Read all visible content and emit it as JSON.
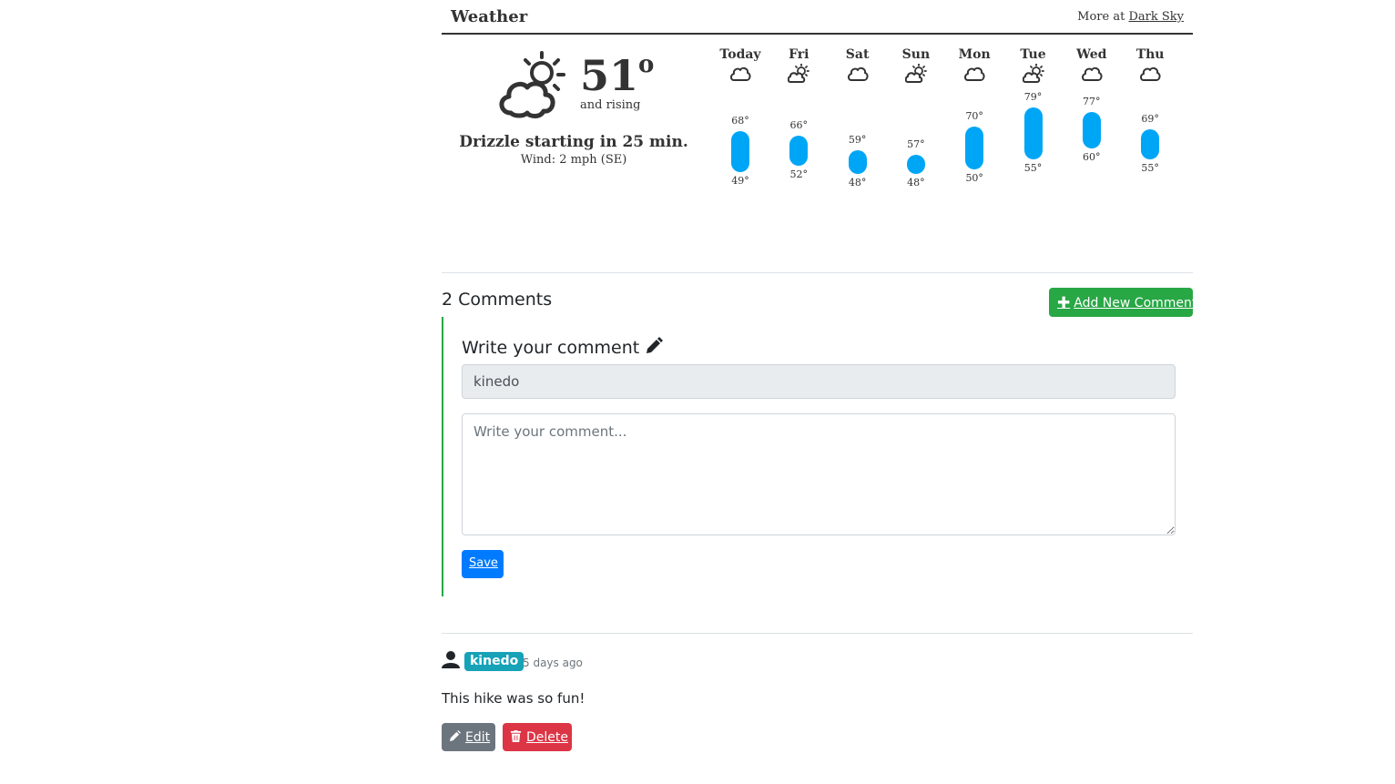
{
  "weather": {
    "title": "Weather",
    "more_prefix": "More at",
    "more_link": "Dark Sky",
    "current": {
      "temp": "51",
      "degree": "o",
      "trend": "and rising",
      "summary": "Drizzle starting in 25 min.",
      "wind": "Wind: 2 mph (SE)",
      "icon": "partly-cloudy-day-icon"
    },
    "forecast": [
      {
        "day": "Today",
        "icon": "cloudy-icon",
        "high": 68,
        "low": 49
      },
      {
        "day": "Fri",
        "icon": "partly-cloudy-icon",
        "high": 66,
        "low": 52
      },
      {
        "day": "Sat",
        "icon": "cloudy-icon",
        "high": 59,
        "low": 48
      },
      {
        "day": "Sun",
        "icon": "partly-cloudy-icon",
        "high": 57,
        "low": 48
      },
      {
        "day": "Mon",
        "icon": "cloudy-icon",
        "high": 70,
        "low": 50
      },
      {
        "day": "Tue",
        "icon": "partly-cloudy-icon",
        "high": 79,
        "low": 55
      },
      {
        "day": "Wed",
        "icon": "cloudy-icon",
        "high": 77,
        "low": 60
      },
      {
        "day": "Thu",
        "icon": "cloudy-icon",
        "high": 69,
        "low": 55
      }
    ],
    "bar_color": "#00a6f6"
  },
  "comments": {
    "count_label": "2 Comments",
    "add_button": "Add New Comment",
    "form": {
      "heading": "Write your comment",
      "username": "kinedo",
      "placeholder": "Write your comment...",
      "save_label": "Save"
    },
    "items": [
      {
        "user": "kinedo",
        "time": "5 days ago",
        "body": "This hike was so fun!",
        "edit_label": "Edit",
        "delete_label": "Delete"
      }
    ]
  },
  "colors": {
    "success": "#28a745",
    "primary": "#007bff",
    "info": "#17a2b8",
    "secondary": "#6c757d",
    "danger": "#dc3545"
  }
}
